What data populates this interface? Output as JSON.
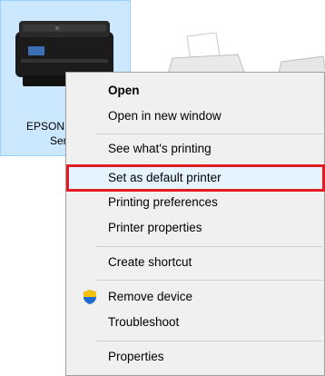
{
  "devices": [
    {
      "label_line1": "EPSON",
      "label_line2": "Ser",
      "selected": true,
      "icon": "printer-icon"
    },
    {
      "icon": "fax-printer-icon"
    },
    {
      "icon": "printer-icon"
    }
  ],
  "context_menu": {
    "items": [
      {
        "label": "Open",
        "bold": true
      },
      {
        "label": "Open in new window"
      },
      {
        "label": "See what's printing"
      },
      {
        "label": "Set as default printer",
        "highlighted": true
      },
      {
        "label": "Printing preferences"
      },
      {
        "label": "Printer properties"
      },
      {
        "label": "Create shortcut"
      },
      {
        "label": "Remove device",
        "icon": "shield-icon"
      },
      {
        "label": "Troubleshoot"
      },
      {
        "label": "Properties"
      }
    ]
  },
  "colors": {
    "selection_bg": "#cce8ff",
    "menu_bg": "#f0f0f0",
    "highlight_border": "#e31b23"
  }
}
